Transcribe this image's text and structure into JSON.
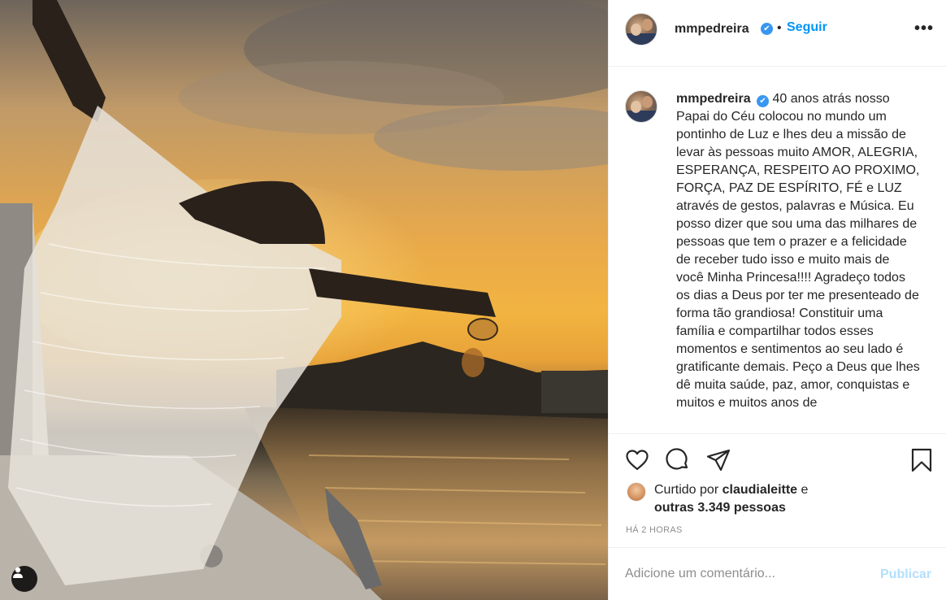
{
  "post": {
    "image_alt": "",
    "user_tag_icon": "person-icon"
  },
  "header": {
    "username": "mmpedreira",
    "verified_glyph": "✔",
    "separator": "•",
    "follow_label": "Seguir",
    "more_label": "•••"
  },
  "caption": {
    "username": "mmpedreira",
    "verified_glyph": "✔",
    "text": "40 anos atrás nosso Papai do Céu colocou no mundo um pontinho de Luz e lhes deu a missão de levar às pessoas muito AMOR, ALEGRIA, ESPERANÇA, RESPEITO AO PROXIMO, FORÇA, PAZ DE ESPÍRITO, FÉ e LUZ através de gestos, palavras e Música. Eu posso dizer que sou uma das milhares de pessoas que tem o prazer e a felicidade de receber tudo isso e muito mais de você Minha Princesa!!!! Agradeço todos os dias a Deus por ter me presenteado de forma tão grandiosa! Constituir uma família e compartilhar todos esses momentos e sentimentos ao seu lado é gratificante demais. Peço a Deus que lhes dê muita saúde, paz, amor, conquistas e muitos e muitos anos de"
  },
  "actions": {
    "icons": [
      "heart-icon",
      "comment-icon",
      "share-icon",
      "bookmark-icon"
    ]
  },
  "likes": {
    "prefix": "Curtido por ",
    "user": "claudialeitte",
    "middle": " e",
    "others": "outras 3.349 pessoas"
  },
  "timestamp": "HÁ 2 HORAS",
  "comment": {
    "placeholder": "Adicione um comentário...",
    "publish_label": "Publicar"
  },
  "colors": {
    "accent": "#0095f6",
    "verified": "#3897f0",
    "publish_disabled": "#b2dffc",
    "muted": "#8e8e8e"
  }
}
